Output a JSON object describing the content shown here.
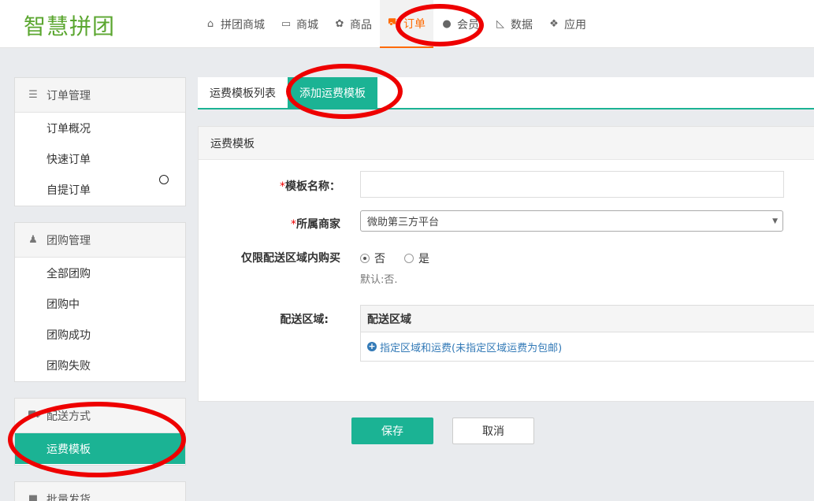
{
  "header": {
    "logo": "智慧拼团",
    "nav": [
      {
        "label": "拼团商城",
        "icon": "home-icon",
        "glyph": "⌂"
      },
      {
        "label": "商城",
        "icon": "monitor-icon",
        "glyph": "▭"
      },
      {
        "label": "商品",
        "icon": "gift-icon",
        "glyph": "✿"
      },
      {
        "label": "订单",
        "icon": "cart-icon",
        "glyph": "⛟"
      },
      {
        "label": "会员",
        "icon": "user-icon",
        "glyph": "●"
      },
      {
        "label": "数据",
        "icon": "chart-icon",
        "glyph": "◺"
      },
      {
        "label": "应用",
        "icon": "apps-icon",
        "glyph": "❖"
      }
    ],
    "active_nav": "订单"
  },
  "sidebar": {
    "order_mgmt": {
      "title": "订单管理",
      "icon": "list-icon",
      "items": [
        "订单概况",
        "快速订单",
        "自提订单"
      ]
    },
    "group_mgmt": {
      "title": "团购管理",
      "icon": "users-icon",
      "items": [
        "全部团购",
        "团购中",
        "团购成功",
        "团购失败"
      ]
    },
    "delivery": {
      "title": "配送方式",
      "icon": "truck-icon",
      "items": [
        "运费模板"
      ]
    },
    "batch": {
      "title": "批量发货"
    }
  },
  "tabs": {
    "list": "运费模板列表",
    "add": "添加运费模板"
  },
  "form": {
    "section_title": "运费模板",
    "name_label": "模板名称：",
    "name_value": "",
    "merchant_label": "所属商家",
    "merchant_value": "微助第三方平台",
    "restrict_label": "仅限配送区域内购买",
    "restrict_no": "否",
    "restrict_yes": "是",
    "restrict_selected": "否",
    "restrict_hint": "默认:否.",
    "area_label": "配送区域:",
    "area_header": "配送区域",
    "area_link": "指定区域和运费(未指定区域运费为包邮)",
    "required_mark": "*"
  },
  "buttons": {
    "save": "保存",
    "cancel": "取消"
  },
  "colors": {
    "accent": "#1bb394",
    "nav_active": "#ff6a00",
    "logo": "#5aa62f",
    "annotation": "#e00000"
  }
}
